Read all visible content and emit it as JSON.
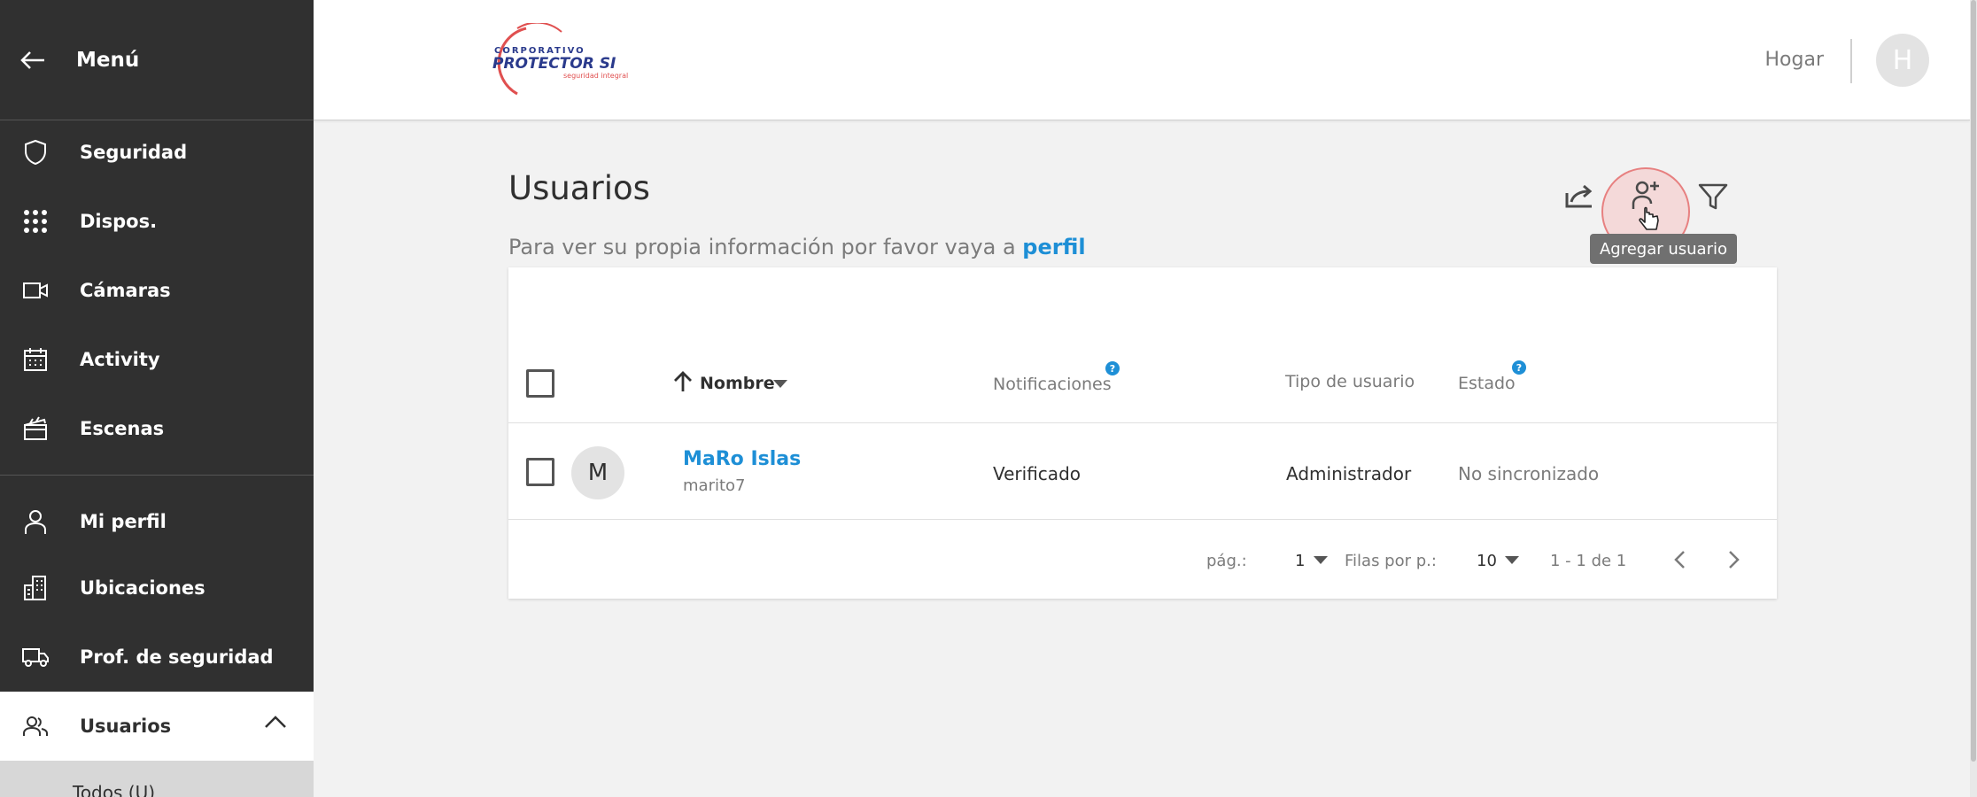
{
  "sidebar": {
    "header_label": "Menú",
    "items": [
      {
        "label": "Seguridad",
        "icon": "shield-icon"
      },
      {
        "label": "Dispos.",
        "icon": "grid-icon"
      },
      {
        "label": "Cámaras",
        "icon": "camera-icon"
      },
      {
        "label": "Activity",
        "icon": "calendar-icon"
      },
      {
        "label": "Escenas",
        "icon": "clapperboard-icon"
      },
      {
        "label": "Mi perfil",
        "icon": "user-icon"
      },
      {
        "label": "Ubicaciones",
        "icon": "building-icon"
      },
      {
        "label": "Prof. de seguridad",
        "icon": "truck-icon"
      },
      {
        "label": "Usuarios",
        "icon": "users-icon"
      }
    ],
    "active_item": "Usuarios",
    "sub_item": "Todos (U)"
  },
  "topbar": {
    "logo": {
      "line1": "CORPORATIVO",
      "line2": "PROTECTOR SI",
      "line3": "seguridad integral"
    },
    "home_label": "Hogar",
    "avatar_letter": "H"
  },
  "page": {
    "title": "Usuarios",
    "subtitle": "Para ver su propia información por favor vaya a",
    "profile_link": "perfil"
  },
  "toolbar": {
    "tooltip": "Agregar usuario"
  },
  "table": {
    "columns": {
      "name": "Nombre",
      "notifications": "Notificaciones",
      "user_type": "Tipo de usuario",
      "status": "Estado"
    },
    "help_glyph": "?",
    "rows": [
      {
        "avatar_letter": "M",
        "name": "MaRo Islas",
        "login": "marito7",
        "notifications": "Verificado",
        "user_type": "Administrador",
        "status": "No sincronizado"
      }
    ]
  },
  "pagination": {
    "page_label": "pág.:",
    "page_value": "1",
    "rows_label": "Filas por p.:",
    "rows_value": "10",
    "range": "1 - 1 de 1"
  },
  "colors": {
    "sidebar_bg": "#303030",
    "accent": "#1e8fd6",
    "logo_red": "#e05050",
    "logo_navy": "#2a3a8c"
  }
}
